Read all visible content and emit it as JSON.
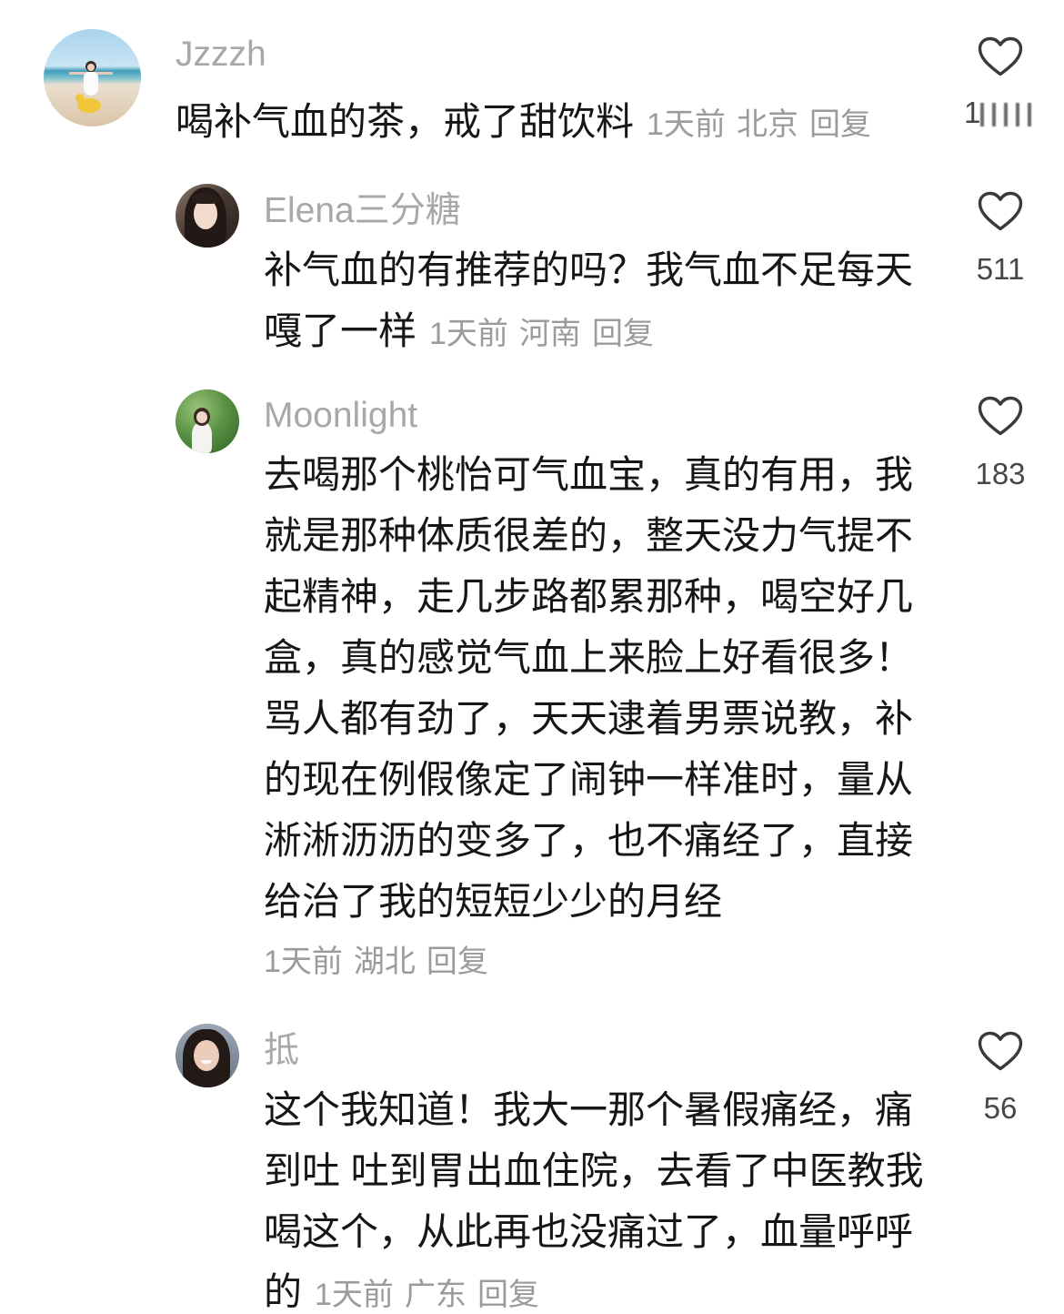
{
  "comments": [
    {
      "username": "Jzzzh",
      "lines": [
        "喝补气血的茶，戒了甜饮料"
      ],
      "time": "1天前",
      "location": "北京",
      "reply_label": "回复",
      "like_count": "1",
      "like_count_obscured": true
    },
    {
      "username": "Elena三分糖",
      "lines": [
        "补气血的有推荐的吗？我气血不足每天",
        "嘎了一样"
      ],
      "time": "1天前",
      "location": "河南",
      "reply_label": "回复",
      "like_count": "511"
    },
    {
      "username": "Moonlight",
      "lines": [
        "去喝那个桃怡可气血宝，真的有用，我",
        "就是那种体质很差的，整天没力气提不",
        "起精神，走几步路都累那种，喝空好几",
        "盒，真的感觉气血上来脸上好看很多！",
        "骂人都有劲了，天天逮着男票说教，补",
        "的现在例假像定了闹钟一样准时，量从",
        "淅淅沥沥的变多了，也不痛经了，直接",
        "给治了我的短短少少的月经"
      ],
      "time": "1天前",
      "location": "湖北",
      "reply_label": "回复",
      "like_count": "183"
    },
    {
      "username": "抵",
      "lines": [
        "这个我知道！我大一那个暑假痛经，痛",
        "到吐 吐到胃出血住院，去看了中医教我",
        "喝这个，从此再也没痛过了，血量呼呼",
        "的"
      ],
      "time": "1天前",
      "location": "广东",
      "reply_label": "回复",
      "like_count": "56"
    }
  ],
  "icons": {
    "like": "heart-outline-icon",
    "avatar": "user-photo"
  },
  "colors": {
    "background": "#ffffff",
    "text": "#161616",
    "username": "#a8a8a8",
    "meta": "#9b9b9b",
    "icon": "#3a3a3a",
    "count": "#474747"
  }
}
